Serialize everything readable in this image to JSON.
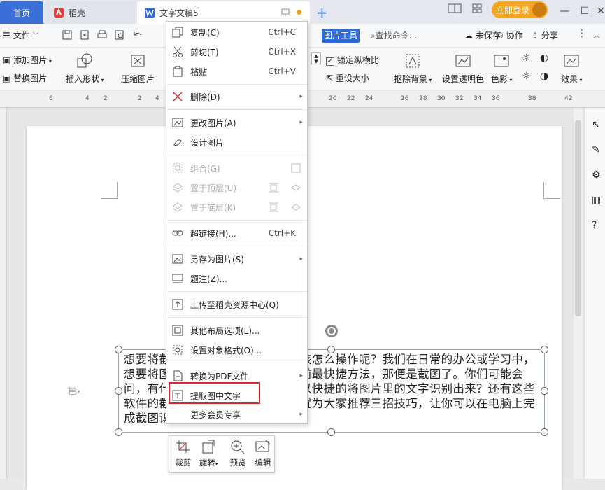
{
  "tabs": {
    "home": "首页",
    "daoke": "稻壳",
    "doc": "文字文稿5",
    "new_tab": "+"
  },
  "titlebar": {
    "login": "立即登录"
  },
  "menubar": {
    "file": "文件",
    "picture_tools": "图片工具",
    "search": "查找命令...",
    "unsaved": "未保存",
    "collab": "协作",
    "share": "分享"
  },
  "ribbon": {
    "add_picture": "添加图片",
    "replace_picture": "替换图片",
    "insert_shape": "插入形状",
    "compress": "压缩图片",
    "lock_ratio": "锁定纵横比",
    "reset_size": "重设大小",
    "remove_bg": "抠除背景",
    "set_transparent": "设置透明色",
    "color": "色彩",
    "effect": "效果"
  },
  "ruler": [
    "6",
    "4",
    "2",
    "2",
    "4",
    "20",
    "22",
    "24",
    "26",
    "28",
    "30",
    "32",
    "34",
    "36",
    "38",
    "42"
  ],
  "document": {
    "image_text": "想要将截图中的文字提取出来，应该怎么操作呢？我们在日常的办公或学习中，想要将图片中的文字提取出来，目前最快捷方法，那便是截图了。你们可能会问，有什么好的截图识别方法，可以快捷的将图片里的文字识别出来？还有这些软件的截图识别哪个好用呢？今天就为大家推荐三招技巧，让你可以在电脑上完成截图识别操作。"
  },
  "context_menu": {
    "items": [
      {
        "label": "复制(C)",
        "shortcut": "Ctrl+C"
      },
      {
        "label": "剪切(T)",
        "shortcut": "Ctrl+X"
      },
      {
        "label": "粘贴",
        "shortcut": "Ctrl+V"
      },
      {
        "label": "删除(D)"
      },
      {
        "label": "更改图片(A)"
      },
      {
        "label": "设计图片"
      },
      {
        "label": "组合(G)"
      },
      {
        "label": "置于顶层(U)"
      },
      {
        "label": "置于底层(K)"
      },
      {
        "label": "超链接(H)...",
        "shortcut": "Ctrl+K"
      },
      {
        "label": "另存为图片(S)"
      },
      {
        "label": "题注(Z)..."
      },
      {
        "label": "上传至稻壳资源中心(Q)"
      },
      {
        "label": "其他布局选项(L)..."
      },
      {
        "label": "设置对象格式(O)..."
      },
      {
        "label": "转换为PDF文件"
      },
      {
        "label": "提取图中文字"
      },
      {
        "label": "更多会员专享"
      }
    ]
  },
  "mini_toolbar": {
    "crop": "裁剪",
    "rotate": "旋转",
    "preview": "预览",
    "edit": "编辑"
  },
  "colors": {
    "accent": "#2e6bd8",
    "highlight": "#e0262b",
    "login": "#f5a623"
  }
}
